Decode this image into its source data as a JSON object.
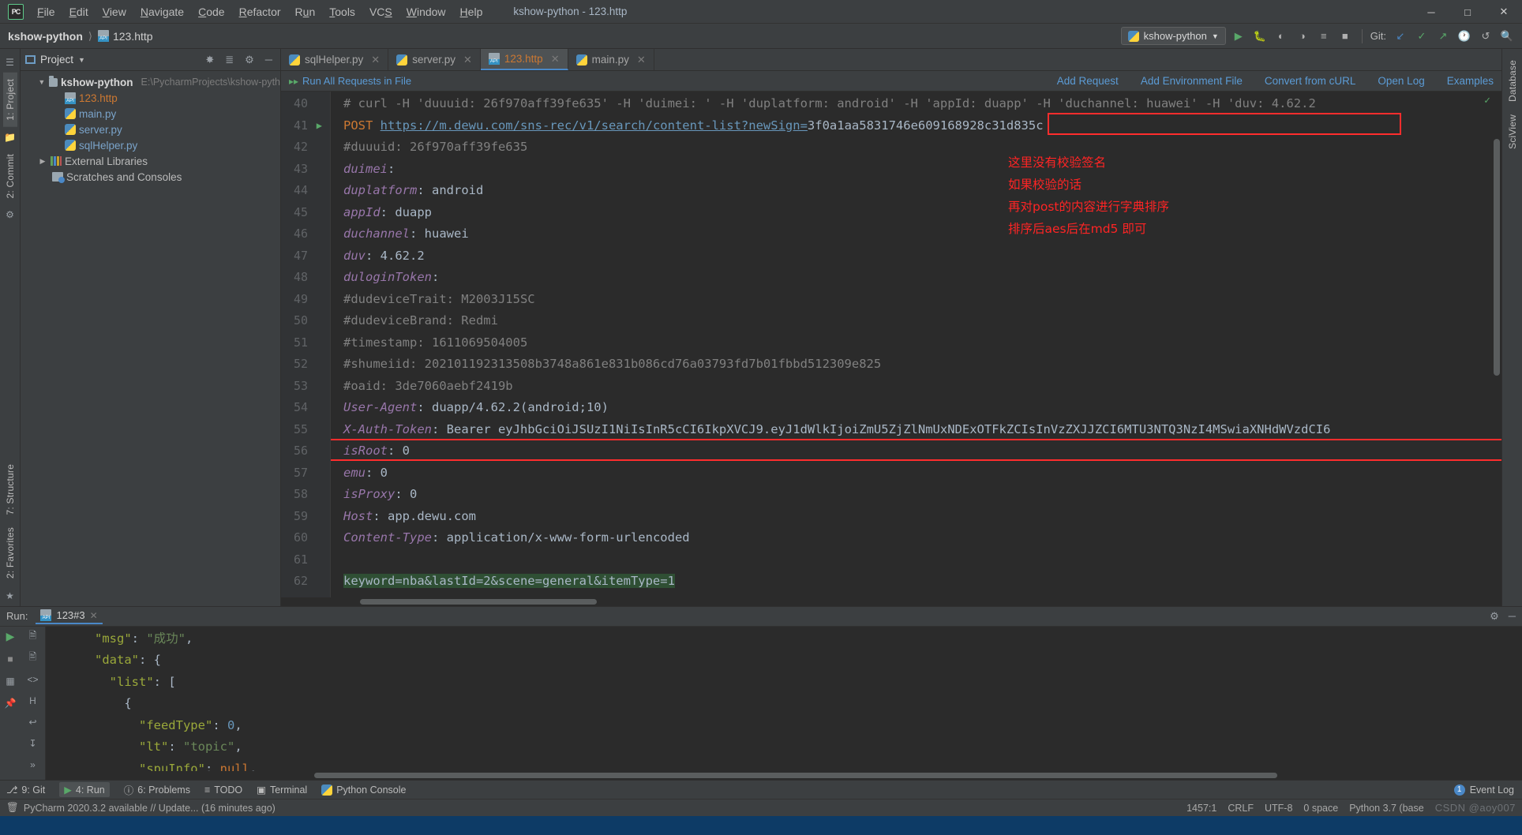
{
  "window": {
    "title": "kshow-python - 123.http",
    "controls": [
      "minimize",
      "maximize",
      "close"
    ]
  },
  "menu": [
    "File",
    "Edit",
    "View",
    "Navigate",
    "Code",
    "Refactor",
    "Run",
    "Tools",
    "VCS",
    "Window",
    "Help"
  ],
  "navbar": {
    "project_crumb": "kshow-python",
    "file_crumb": "123.http",
    "run_config": "kshow-python",
    "git_label": "Git:"
  },
  "project_panel": {
    "title": "Project",
    "root": {
      "label": "kshow-python",
      "path": "E:\\PycharmProjects\\kshow-pyth"
    },
    "items": [
      {
        "label": "123.http",
        "kind": "http"
      },
      {
        "label": "main.py",
        "kind": "py"
      },
      {
        "label": "server.py",
        "kind": "py"
      },
      {
        "label": "sqlHelper.py",
        "kind": "py"
      },
      {
        "label": "External Libraries",
        "kind": "lib"
      },
      {
        "label": "Scratches and Consoles",
        "kind": "scratch"
      }
    ]
  },
  "rails": {
    "left": [
      "1: Project",
      "2: Commit",
      "7: Structure",
      "2: Favorites"
    ],
    "right": [
      "Database",
      "SciView"
    ]
  },
  "tabs": [
    {
      "label": "sqlHelper.py",
      "kind": "py",
      "active": false
    },
    {
      "label": "server.py",
      "kind": "py",
      "active": false
    },
    {
      "label": "123.http",
      "kind": "http",
      "active": true
    },
    {
      "label": "main.py",
      "kind": "py",
      "active": false
    }
  ],
  "http_bar": {
    "run_all": "Run All Requests in File",
    "links": [
      "Add Request",
      "Add Environment File",
      "Convert from cURL",
      "Open Log",
      "Examples"
    ]
  },
  "editor": {
    "first_line_number": 40,
    "lines": [
      {
        "n": 40,
        "type": "comment",
        "text": "# curl -H 'duuuid: 26f970aff39fe635' -H 'duimei: ' -H 'duplatform: android' -H 'appId: duapp' -H 'duchannel: huawei' -H 'duv: 4.62.2"
      },
      {
        "n": 41,
        "type": "request",
        "method": "POST",
        "url": "https://m.dewu.com/sns-rec/v1/search/content-list?newSign=",
        "sign": "3f0a1aa5831746e609168928c31d835c",
        "run_marker": true
      },
      {
        "n": 42,
        "type": "comment",
        "text": "#duuuid: 26f970aff39fe635"
      },
      {
        "n": 43,
        "type": "header",
        "name": "duimei",
        "value": ""
      },
      {
        "n": 44,
        "type": "header",
        "name": "duplatform",
        "value": "android"
      },
      {
        "n": 45,
        "type": "header",
        "name": "appId",
        "value": "duapp"
      },
      {
        "n": 46,
        "type": "header",
        "name": "duchannel",
        "value": "huawei"
      },
      {
        "n": 47,
        "type": "header",
        "name": "duv",
        "value": "4.62.2"
      },
      {
        "n": 48,
        "type": "header",
        "name": "duloginToken",
        "value": ""
      },
      {
        "n": 49,
        "type": "comment",
        "text": "#dudeviceTrait: M2003J15SC"
      },
      {
        "n": 50,
        "type": "comment",
        "text": "#dudeviceBrand: Redmi"
      },
      {
        "n": 51,
        "type": "comment",
        "text": "#timestamp: 1611069504005"
      },
      {
        "n": 52,
        "type": "comment",
        "text": "#shumeiid: 202101192313508b3748a861e831b086cd76a03793fd7b01fbbd512309e825"
      },
      {
        "n": 53,
        "type": "comment",
        "text": "#oaid: 3de7060aebf2419b"
      },
      {
        "n": 54,
        "type": "header",
        "name": "User-Agent",
        "value": "duapp/4.62.2(android;10)"
      },
      {
        "n": 55,
        "type": "header",
        "name": "X-Auth-Token",
        "value": "Bearer eyJhbGciOiJSUzI1NiIsInR5cCI6IkpXVCJ9.eyJ1dWlkIjoiZmU5ZjZlNmUxNDExOTFkZCIsInVzZXJJZCI6MTU3NTQ3NzI4MSwiaXNHdWVzdCI6",
        "boxed": true
      },
      {
        "n": 56,
        "type": "header",
        "name": "isRoot",
        "value": "0"
      },
      {
        "n": 57,
        "type": "header",
        "name": "emu",
        "value": "0"
      },
      {
        "n": 58,
        "type": "header",
        "name": "isProxy",
        "value": "0"
      },
      {
        "n": 59,
        "type": "header",
        "name": "Host",
        "value": "app.dewu.com"
      },
      {
        "n": 60,
        "type": "header",
        "name": "Content-Type",
        "value": "application/x-www-form-urlencoded"
      },
      {
        "n": 61,
        "type": "blank",
        "text": ""
      },
      {
        "n": 62,
        "type": "body",
        "text": "keyword=nba&lastId=2&scene=general&itemType=1"
      }
    ]
  },
  "annotations": [
    "这里没有校验签名",
    "如果校验的话",
    "再对post的内容进行字典排序",
    "排序后aes后在md5 即可"
  ],
  "run_panel": {
    "label": "Run:",
    "tab": "123#3",
    "console_lines": [
      {
        "indent": 2,
        "parts": [
          {
            "t": "\"msg\"",
            "c": "jkey"
          },
          {
            "t": ": ",
            "c": "jp"
          },
          {
            "t": "\"成功\"",
            "c": "jstr"
          },
          {
            "t": ",",
            "c": "jp"
          }
        ]
      },
      {
        "indent": 2,
        "parts": [
          {
            "t": "\"data\"",
            "c": "jkey"
          },
          {
            "t": ": {",
            "c": "jp"
          }
        ]
      },
      {
        "indent": 3,
        "parts": [
          {
            "t": "\"list\"",
            "c": "jkey"
          },
          {
            "t": ": [",
            "c": "jp"
          }
        ]
      },
      {
        "indent": 4,
        "parts": [
          {
            "t": "{",
            "c": "jp"
          }
        ]
      },
      {
        "indent": 5,
        "parts": [
          {
            "t": "\"feedType\"",
            "c": "jkey"
          },
          {
            "t": ": ",
            "c": "jp"
          },
          {
            "t": "0",
            "c": "jnum"
          },
          {
            "t": ",",
            "c": "jp"
          }
        ]
      },
      {
        "indent": 5,
        "parts": [
          {
            "t": "\"lt\"",
            "c": "jkey"
          },
          {
            "t": ": ",
            "c": "jp"
          },
          {
            "t": "\"topic\"",
            "c": "jstr"
          },
          {
            "t": ",",
            "c": "jp"
          }
        ]
      },
      {
        "indent": 5,
        "parts": [
          {
            "t": "\"spuInfo\"",
            "c": "jkey"
          },
          {
            "t": ": ",
            "c": "jp"
          },
          {
            "t": "null",
            "c": "jnull"
          },
          {
            "t": ",",
            "c": "jp"
          }
        ]
      }
    ]
  },
  "tool_strip": {
    "items": [
      "9: Git",
      "4: Run",
      "6: Problems",
      "TODO",
      "Terminal",
      "Python Console"
    ],
    "selected": "4: Run",
    "event_log": "Event Log",
    "event_count": "1"
  },
  "statusbar": {
    "message": "PyCharm 2020.3.2 available // Update... (16 minutes ago)",
    "caret": "1457:1",
    "line_sep": "CRLF",
    "encoding": "UTF-8",
    "indent": "0 space",
    "interpreter": "Python 3.7 (base",
    "watermark": "CSDN @aoy007"
  },
  "colors": {
    "accent_blue": "#4a88c7",
    "link_blue": "#5b9bd5",
    "green": "#59a869",
    "red_box": "#ff2d2d",
    "annot_red": "#ff2424",
    "editor_bg": "#2b2b2b",
    "panel_bg": "#3c3f41"
  }
}
